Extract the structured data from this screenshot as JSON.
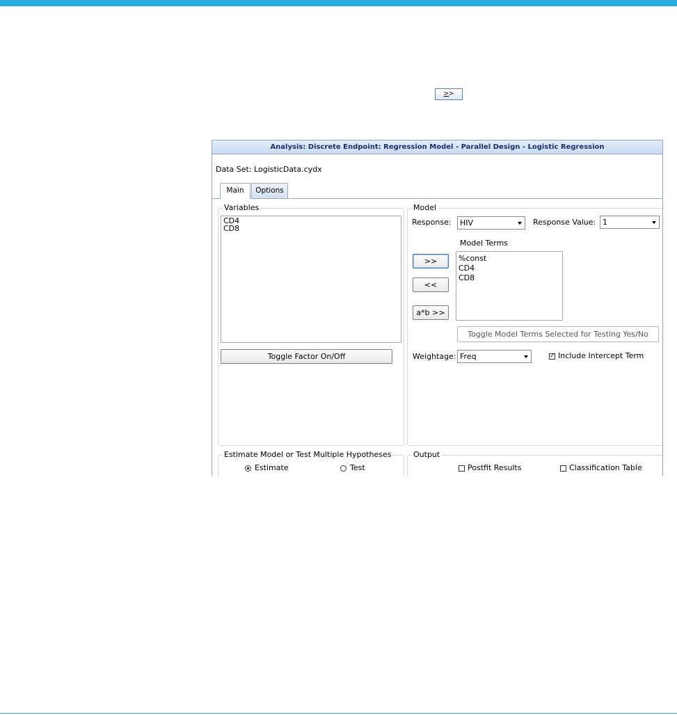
{
  "nav_button": {
    "label": ">",
    "label2": ">"
  },
  "window": {
    "title": "Analysis: Discrete Endpoint: Regression Model - Parallel Design - Logistic Regression",
    "dataset": "Data Set: LogisticData.cydx",
    "tabs": [
      {
        "label": "Main"
      },
      {
        "label": "Options"
      }
    ]
  },
  "variables": {
    "legend": "Variables",
    "items": [
      "CD4",
      "CD8"
    ],
    "toggle_button": "Toggle Factor On/Off"
  },
  "model": {
    "legend": "Model",
    "response_label": "Response:",
    "response_value": "HIV",
    "response_value_label": "Response Value:",
    "response_value_selected": "1",
    "terms_label": "Model Terms",
    "terms": [
      "%const",
      "CD4",
      "CD8"
    ],
    "add_button": ">>",
    "remove_button": "<<",
    "interaction_button": "a*b >>",
    "toggle_testing_button": "Toggle Model Terms Selected for Testing Yes/No",
    "weightage_label": "Weightage:",
    "weightage_value": "Freq",
    "intercept_label": "Include Intercept Term",
    "intercept_checked": true
  },
  "estimate_group": {
    "legend": "Estimate Model or Test Multiple Hypotheses",
    "estimate_label": "Estimate",
    "test_label": "Test",
    "selected": "Estimate"
  },
  "output_group": {
    "legend": "Output",
    "postfit_label": "Postfit Results",
    "postfit_checked": false,
    "classification_label": "Classification Table",
    "classification_checked": false
  },
  "colors": {
    "accent": "#29abe2",
    "title_text": "#1a2e6c",
    "button_focus": "#3b73c8"
  }
}
